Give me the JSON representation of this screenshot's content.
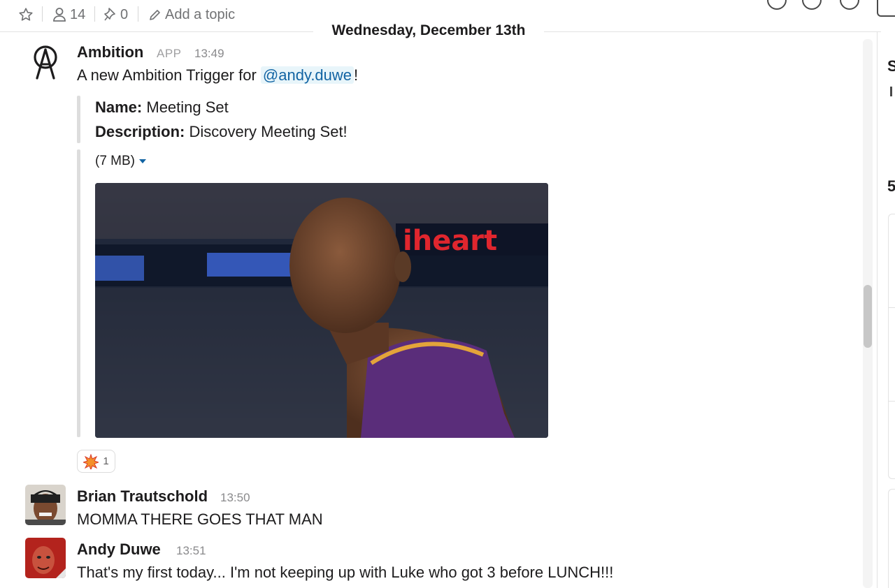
{
  "header": {
    "star_icon": "star-icon",
    "members_count": "14",
    "pins_count": "0",
    "topic_placeholder": "Add a topic"
  },
  "date_divider": "Wednesday, December 13th",
  "messages": [
    {
      "author": "Ambition",
      "badge": "APP",
      "time": "13:49",
      "text_before": "A new Ambition Trigger for ",
      "mention": "@andy.duwe",
      "text_after": "!",
      "fields": [
        {
          "label": "Name:",
          "value": " Meeting Set"
        },
        {
          "label": "Description:",
          "value": " Discovery Meeting Set!"
        }
      ],
      "file_size": "(7 MB)",
      "gif_text": "iheart",
      "reaction": {
        "icon": "collision-icon",
        "count": "1"
      }
    },
    {
      "author": "Brian Trautschold",
      "time": "13:50",
      "text": "MOMMA THERE GOES THAT MAN"
    },
    {
      "author": "Andy Duwe",
      "time": "13:51",
      "text": "That's my first today... I'm not keeping up with Luke who got 3 before LUNCH!!!"
    }
  ],
  "right_panel": {
    "letter_top": "S",
    "letter_mid": "5"
  },
  "colors": {
    "mention_bg": "#e8f5fa",
    "mention_text": "#1264a3",
    "header_text": "#717274"
  }
}
